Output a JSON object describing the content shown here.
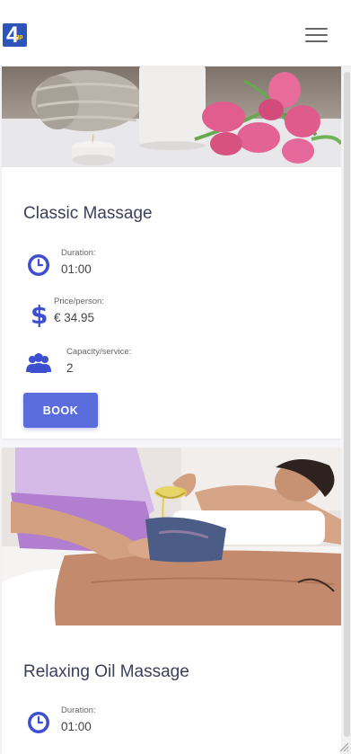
{
  "colors": {
    "accent": "#5b6cdd",
    "icon": "#3d4fd0",
    "title": "#3c3f5a"
  },
  "header": {
    "logo_text": "4",
    "logo_subtext": "gp"
  },
  "cards": [
    {
      "title": "Classic Massage",
      "duration": {
        "label": "Duration:",
        "value": "01:00",
        "icon": "clock-icon"
      },
      "price": {
        "label": "Price/person:",
        "value": "€ 34.95",
        "icon": "dollar-icon"
      },
      "capacity": {
        "label": "Capacity/service:",
        "value": "2",
        "icon": "users-icon"
      },
      "book_label": "BOOK"
    },
    {
      "title": "Relaxing Oil Massage",
      "duration": {
        "label": "Duration:",
        "value": "01:00",
        "icon": "clock-icon"
      }
    }
  ]
}
